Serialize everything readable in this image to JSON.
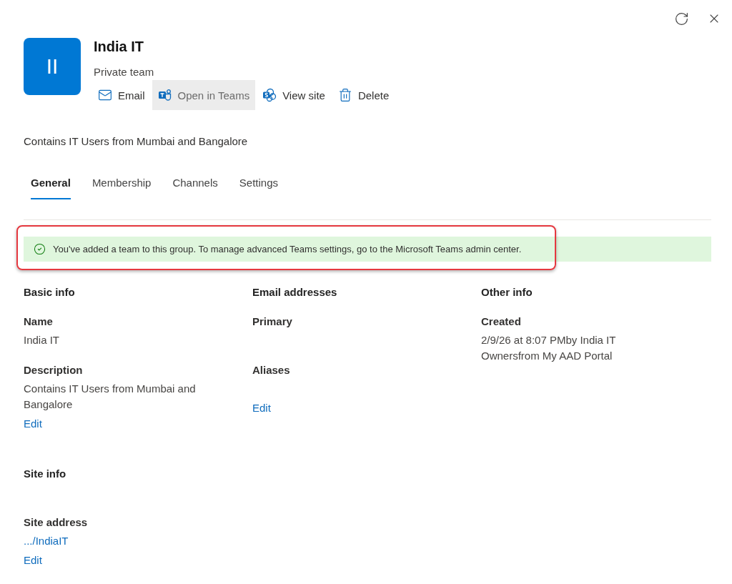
{
  "window_controls": [
    {
      "kind": "refresh"
    },
    {
      "kind": "close"
    }
  ],
  "group": {
    "initials": "II",
    "name": "India IT",
    "type": "Private team",
    "description": "Contains IT Users from Mumbai and Bangalore"
  },
  "actions": [
    {
      "kind": "email",
      "label": "Email",
      "hovered": false
    },
    {
      "kind": "teams",
      "label": "Open in Teams",
      "hovered": true
    },
    {
      "kind": "site",
      "label": "View site",
      "hovered": false
    },
    {
      "kind": "delete",
      "label": "Delete",
      "hovered": false
    }
  ],
  "tabs": [
    {
      "label": "General",
      "selected": true
    },
    {
      "label": "Membership",
      "selected": false
    },
    {
      "label": "Channels",
      "selected": false
    },
    {
      "label": "Settings",
      "selected": false
    }
  ],
  "notice": {
    "kind": "success",
    "text": "You've added a team to this group. To manage advanced Teams settings, go to the Microsoft Teams admin center.",
    "highlighted": true
  },
  "sections": [
    {
      "title": "Basic info",
      "fields": [
        {
          "label": "Name",
          "value": "India IT",
          "kind": "text"
        },
        {
          "label": "Description",
          "value": "Contains IT Users from Mumbai and Bangalore",
          "kind": "text",
          "action": "Edit"
        }
      ]
    },
    {
      "title": "Email addresses",
      "fields": [
        {
          "label": "Primary"
        },
        {
          "label": "Aliases",
          "action": "Edit"
        }
      ]
    },
    {
      "title": "Other info",
      "fields": [
        {
          "label": "Created",
          "value": "2/9/26 at 8:07 PMby India IT Ownersfrom My AAD Portal",
          "kind": "text"
        }
      ]
    },
    {
      "title": "Site info",
      "fields": [
        {
          "label": "Site address",
          "value": ".../IndiaIT",
          "kind": "link",
          "action": "Edit"
        }
      ]
    }
  ]
}
